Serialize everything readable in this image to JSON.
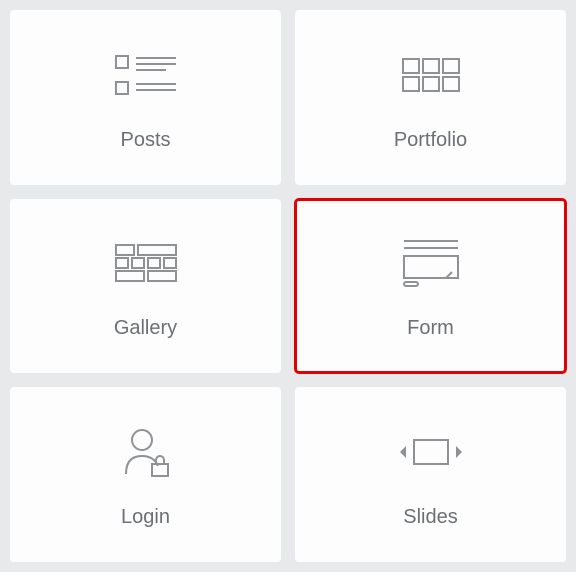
{
  "tiles": [
    {
      "id": "posts",
      "label": "Posts",
      "icon": "posts-icon",
      "selected": false
    },
    {
      "id": "portfolio",
      "label": "Portfolio",
      "icon": "portfolio-icon",
      "selected": false
    },
    {
      "id": "gallery",
      "label": "Gallery",
      "icon": "gallery-icon",
      "selected": false
    },
    {
      "id": "form",
      "label": "Form",
      "icon": "form-icon",
      "selected": true
    },
    {
      "id": "login",
      "label": "Login",
      "icon": "login-icon",
      "selected": false
    },
    {
      "id": "slides",
      "label": "Slides",
      "icon": "slides-icon",
      "selected": false
    }
  ],
  "colors": {
    "selection": "#e30000",
    "icon": "#8e9297",
    "label": "#6b7076"
  }
}
